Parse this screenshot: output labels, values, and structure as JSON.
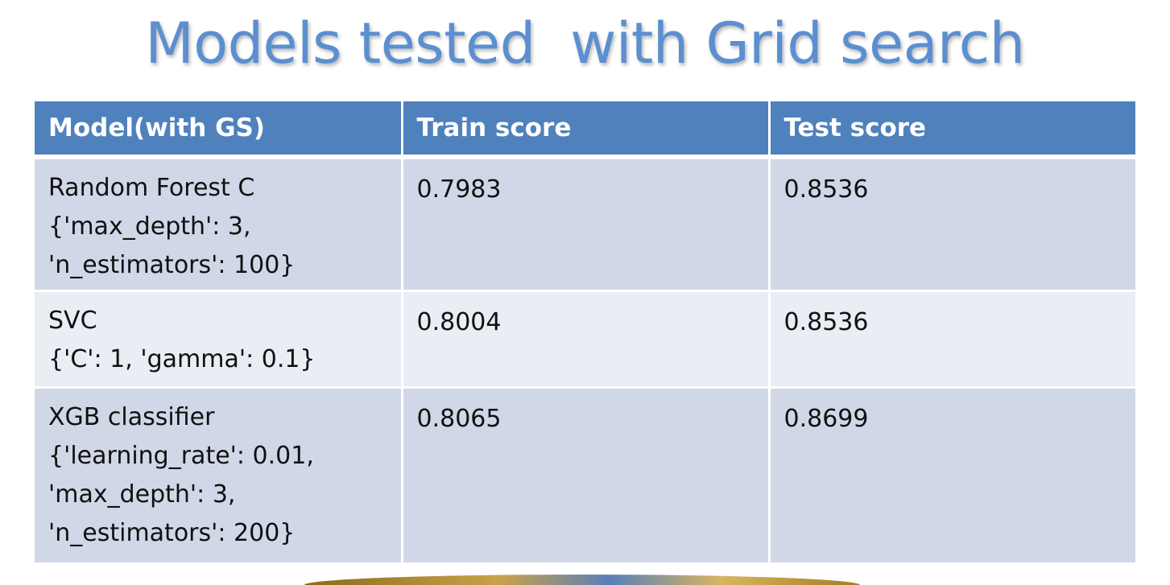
{
  "slide": {
    "title": "Models tested  with Grid search"
  },
  "table": {
    "headers": [
      "Model(with GS)",
      "Train score",
      "Test score"
    ],
    "rows": [
      {
        "model_name": "Random Forest C",
        "model_params": "{'max_depth': 3,\n'n_estimators': 100}",
        "train_score": "0.7983",
        "test_score": "0.8536"
      },
      {
        "model_name": "SVC",
        "model_params": "{'C': 1, 'gamma': 0.1}",
        "train_score": "0.8004",
        "test_score": "0.8536"
      },
      {
        "model_name": "XGB classifier",
        "model_params": "{'learning_rate': 0.01,\n'max_depth': 3,\n'n_estimators': 200}",
        "train_score": "0.8065",
        "test_score": "0.8699"
      }
    ]
  },
  "colors": {
    "title": "#5b8fd0",
    "header_bg": "#4f81bd",
    "row_odd": "#d0d8e8",
    "row_even": "#e9edf4"
  }
}
